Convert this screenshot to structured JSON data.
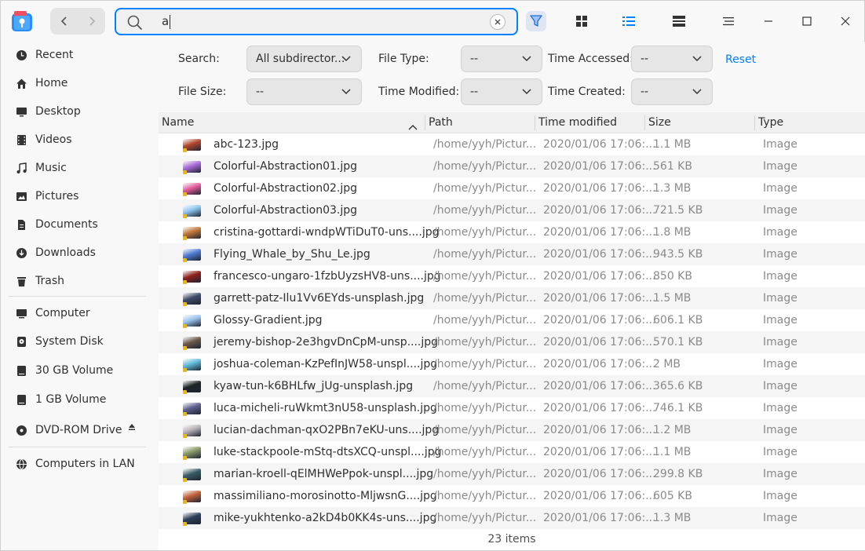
{
  "toolbar": {
    "search_value": "a",
    "view_icons": [
      "filter-icon",
      "grid-view-icon",
      "list-view-icon",
      "detail-pane-icon",
      "menu-icon",
      "minimize-icon",
      "maximize-icon",
      "close-icon"
    ]
  },
  "sidebar": {
    "items": [
      {
        "label": "Recent",
        "icon": "clock-icon"
      },
      {
        "label": "Home",
        "icon": "home-icon"
      },
      {
        "label": "Desktop",
        "icon": "desktop-icon"
      },
      {
        "label": "Videos",
        "icon": "video-icon"
      },
      {
        "label": "Music",
        "icon": "music-icon"
      },
      {
        "label": "Pictures",
        "icon": "picture-icon"
      },
      {
        "label": "Documents",
        "icon": "document-icon"
      },
      {
        "label": "Downloads",
        "icon": "download-icon"
      },
      {
        "label": "Trash",
        "icon": "trash-icon"
      }
    ],
    "devices": [
      {
        "label": "Computer",
        "icon": "computer-icon"
      },
      {
        "label": "System Disk",
        "icon": "disk-icon"
      },
      {
        "label": "30 GB Volume",
        "icon": "drive-icon"
      },
      {
        "label": "1 GB Volume",
        "icon": "drive-icon"
      },
      {
        "label": "DVD-ROM Drive",
        "icon": "dvd-icon"
      }
    ],
    "network": [
      {
        "label": "Computers in LAN",
        "icon": "network-icon"
      }
    ]
  },
  "filters": {
    "search_label": "Search:",
    "search_value": "All subdirector...",
    "file_type_label": "File Type:",
    "file_type_value": "--",
    "time_accessed_label": "Time Accessed:",
    "time_accessed_value": "--",
    "reset_label": "Reset",
    "file_size_label": "File Size:",
    "file_size_value": "--",
    "time_modified_label": "Time Modified:",
    "time_modified_value": "--",
    "time_created_label": "Time Created:",
    "time_created_value": "--"
  },
  "list": {
    "columns": {
      "name": "Name",
      "path": "Path",
      "time": "Time modified",
      "size": "Size",
      "type": "Type"
    },
    "rows": [
      {
        "name": "abc-123.jpg",
        "path": "/home/yyh/Pictur...",
        "time": "2020/01/06 17:06:...",
        "size": "1.1 MB",
        "type": "Image",
        "thumb": "#b2472e"
      },
      {
        "name": "Colorful-Abstraction01.jpg",
        "path": "/home/yyh/Pictur...",
        "time": "2020/01/06 17:06:...",
        "size": "561 KB",
        "type": "Image",
        "thumb": "#a86ad8"
      },
      {
        "name": "Colorful-Abstraction02.jpg",
        "path": "/home/yyh/Pictur...",
        "time": "2020/01/06 17:06:...",
        "size": "1.3 MB",
        "type": "Image",
        "thumb": "#e25c9a"
      },
      {
        "name": "Colorful-Abstraction03.jpg",
        "path": "/home/yyh/Pictur...",
        "time": "2020/01/06 17:06:...",
        "size": "721.5 KB",
        "type": "Image",
        "thumb": "#8fc6f0"
      },
      {
        "name": "cristina-gottardi-wndpWTiDuT0-uns....jpg",
        "path": "/home/yyh/Pictur...",
        "time": "2020/01/06 17:06:...",
        "size": "1.8 MB",
        "type": "Image",
        "thumb": "#c2773a"
      },
      {
        "name": "Flying_Whale_by_Shu_Le.jpg",
        "path": "/home/yyh/Pictur...",
        "time": "2020/01/06 17:06:...",
        "size": "943.5 KB",
        "type": "Image",
        "thumb": "#4f7bd0"
      },
      {
        "name": "francesco-ungaro-1fzbUyzsHV8-uns....jpg",
        "path": "/home/yyh/Pictur...",
        "time": "2020/01/06 17:06:...",
        "size": "850 KB",
        "type": "Image",
        "thumb": "#8e1f1c"
      },
      {
        "name": "garrett-patz-Ilu1Vv6EYds-unsplash.jpg",
        "path": "/home/yyh/Pictur...",
        "time": "2020/01/06 17:06:...",
        "size": "1.5 MB",
        "type": "Image",
        "thumb": "#3e4a6a"
      },
      {
        "name": "Glossy-Gradient.jpg",
        "path": "/home/yyh/Pictur...",
        "time": "2020/01/06 17:06:...",
        "size": "606.1 KB",
        "type": "Image",
        "thumb": "#9cc3ef"
      },
      {
        "name": "jeremy-bishop-2e3hgvDnCpM-unsp....jpg",
        "path": "/home/yyh/Pictur...",
        "time": "2020/01/06 17:06:...",
        "size": "570.1 KB",
        "type": "Image",
        "thumb": "#6b5a4c"
      },
      {
        "name": "joshua-coleman-KzPefInJW58-unspl....jpg",
        "path": "/home/yyh/Pictur...",
        "time": "2020/01/06 17:06:...",
        "size": "2 MB",
        "type": "Image",
        "thumb": "#5fb9d8"
      },
      {
        "name": "kyaw-tun-k6BHLfw_jUg-unsplash.jpg",
        "path": "/home/yyh/Pictur...",
        "time": "2020/01/06 17:06:...",
        "size": "365.6 KB",
        "type": "Image",
        "thumb": "#1c2426"
      },
      {
        "name": "luca-micheli-ruWkmt3nU58-unsplash.jpg",
        "path": "/home/yyh/Pictur...",
        "time": "2020/01/06 17:06:...",
        "size": "746.1 KB",
        "type": "Image",
        "thumb": "#5d5f8e"
      },
      {
        "name": "lucian-dachman-qxO2PBn7eKU-uns....jpg",
        "path": "/home/yyh/Pictur...",
        "time": "2020/01/06 17:06:...",
        "size": "1.2 MB",
        "type": "Image",
        "thumb": "#b8b4b8"
      },
      {
        "name": "luke-stackpoole-mStq-dtsXCQ-unspl....jpg",
        "path": "/home/yyh/Pictur...",
        "time": "2020/01/06 17:06:...",
        "size": "1.1 MB",
        "type": "Image",
        "thumb": "#8a9a6a"
      },
      {
        "name": "marian-kroell-qElMHWePpok-unspl....jpg",
        "path": "/home/yyh/Pictur...",
        "time": "2020/01/06 17:06:...",
        "size": "299.8 KB",
        "type": "Image",
        "thumb": "#3a5c66"
      },
      {
        "name": "massimiliano-morosinotto-MljwsnG....jpg",
        "path": "/home/yyh/Pictur...",
        "time": "2020/01/06 17:06:...",
        "size": "605 KB",
        "type": "Image",
        "thumb": "#c0603a"
      },
      {
        "name": "mike-yukhtenko-a2kD4b0KK4s-uns....jpg",
        "path": "/home/yyh/Pictur...",
        "time": "2020/01/06 17:06:...",
        "size": "1.3 MB",
        "type": "Image",
        "thumb": "#2c3f5a"
      }
    ],
    "status": "23 items"
  },
  "colors": {
    "accent": "#0081ff",
    "tag": "#f5b400"
  }
}
